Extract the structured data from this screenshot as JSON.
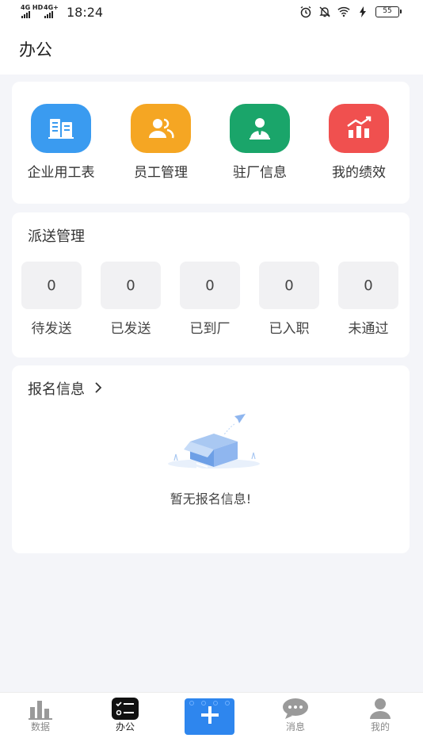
{
  "status_bar": {
    "signal_1": "4G HD",
    "signal_2": "4G+",
    "time": "18:24",
    "battery": "55",
    "icons": [
      "alarm-icon",
      "bell-muted-icon",
      "wifi-icon",
      "charging-icon"
    ]
  },
  "header": {
    "title": "办公"
  },
  "quick_actions": [
    {
      "label": "企业用工表",
      "icon": "building-icon",
      "color": "#3a9bf0"
    },
    {
      "label": "员工管理",
      "icon": "users-icon",
      "color": "#f5a623"
    },
    {
      "label": "驻厂信息",
      "icon": "person-badge-icon",
      "color": "#1aa56a"
    },
    {
      "label": "我的绩效",
      "icon": "chart-up-icon",
      "color": "#f0504f"
    }
  ],
  "dispatch": {
    "title": "派送管理",
    "items": [
      {
        "count": "0",
        "label": "待发送"
      },
      {
        "count": "0",
        "label": "已发送"
      },
      {
        "count": "0",
        "label": "已到厂"
      },
      {
        "count": "0",
        "label": "已入职"
      },
      {
        "count": "0",
        "label": "未通过"
      }
    ]
  },
  "signup": {
    "title": "报名信息",
    "empty_text": "暂无报名信息!"
  },
  "tabbar": {
    "items": [
      {
        "label": "数据",
        "icon": "bar-chart-icon"
      },
      {
        "label": "办公",
        "icon": "checklist-icon",
        "active": true
      },
      {
        "label": "消息",
        "icon": "chat-bubble-icon"
      },
      {
        "label": "我的",
        "icon": "user-icon"
      }
    ],
    "add_icon": "plus-icon"
  },
  "colors": {
    "accent": "#2e86ee",
    "background": "#f4f5f9"
  }
}
